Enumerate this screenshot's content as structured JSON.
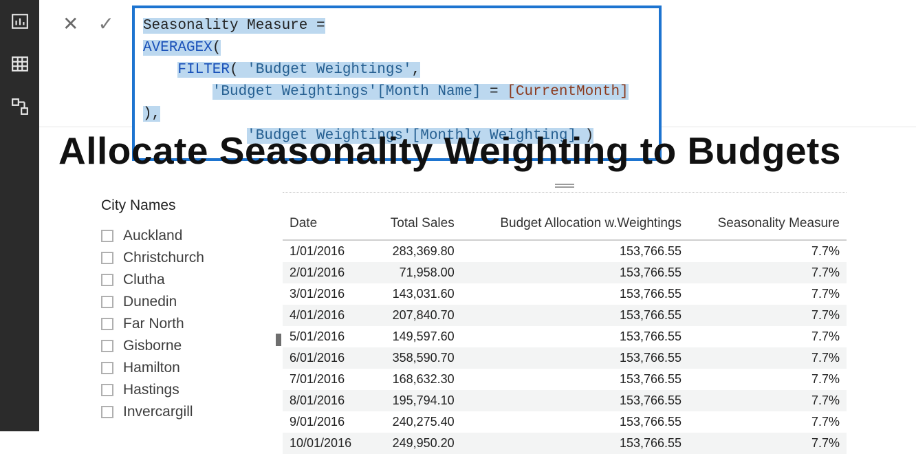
{
  "formula": {
    "line1_prefix": "S",
    "line1_rest": "easonality Measure = ",
    "line2_fn": "AVERAGEX",
    "line2_rest": "(",
    "line3_fn": "FILTER",
    "line3_rest1": "( ",
    "line3_tbl": "'Budget Weightings'",
    "line3_rest2": ",",
    "line4_col": "'Budget Weightings'[Month Name]",
    "line4_mid": " = ",
    "line4_meas": "[CurrentMonth]",
    "line4_end": " ),",
    "line5_col": "'Budget Weightings'[Monthly Weighting]",
    "line5_end": " )"
  },
  "title": "Allocate Seasonality Weighting to Budgets",
  "slicer": {
    "title": "City Names",
    "items": [
      "Auckland",
      "Christchurch",
      "Clutha",
      "Dunedin",
      "Far North",
      "Gisborne",
      "Hamilton",
      "Hastings",
      "Invercargill"
    ]
  },
  "table": {
    "headers": [
      "Date",
      "Total Sales",
      "Budget Allocation w.Weightings",
      "Seasonality Measure"
    ],
    "rows": [
      {
        "date": "1/01/2016",
        "sales": "283,369.80",
        "budget": "153,766.55",
        "season": "7.7%"
      },
      {
        "date": "2/01/2016",
        "sales": "71,958.00",
        "budget": "153,766.55",
        "season": "7.7%"
      },
      {
        "date": "3/01/2016",
        "sales": "143,031.60",
        "budget": "153,766.55",
        "season": "7.7%"
      },
      {
        "date": "4/01/2016",
        "sales": "207,840.70",
        "budget": "153,766.55",
        "season": "7.7%"
      },
      {
        "date": "5/01/2016",
        "sales": "149,597.60",
        "budget": "153,766.55",
        "season": "7.7%"
      },
      {
        "date": "6/01/2016",
        "sales": "358,590.70",
        "budget": "153,766.55",
        "season": "7.7%"
      },
      {
        "date": "7/01/2016",
        "sales": "168,632.30",
        "budget": "153,766.55",
        "season": "7.7%"
      },
      {
        "date": "8/01/2016",
        "sales": "195,794.10",
        "budget": "153,766.55",
        "season": "7.7%"
      },
      {
        "date": "9/01/2016",
        "sales": "240,275.40",
        "budget": "153,766.55",
        "season": "7.7%"
      },
      {
        "date": "10/01/2016",
        "sales": "249,950.20",
        "budget": "153,766.55",
        "season": "7.7%"
      }
    ]
  }
}
